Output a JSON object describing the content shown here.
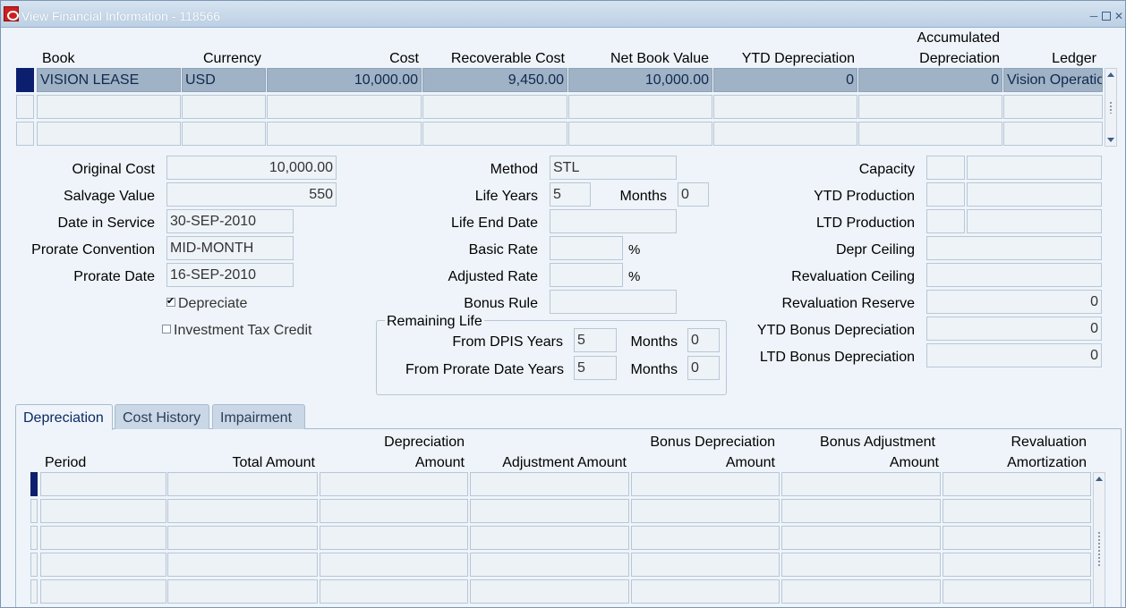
{
  "window": {
    "title": "View Financial Information - 118566"
  },
  "books_table": {
    "headers": {
      "book": "Book",
      "currency": "Currency",
      "cost": "Cost",
      "recoverable_cost": "Recoverable Cost",
      "net_book_value": "Net Book Value",
      "ytd_depreciation": "YTD Depreciation",
      "accumulated_line1": "Accumulated",
      "accumulated_line2": "Depreciation",
      "ledger": "Ledger"
    },
    "rows": [
      {
        "book": "VISION LEASE",
        "currency": "USD",
        "cost": "10,000.00",
        "recoverable_cost": "9,450.00",
        "net_book_value": "10,000.00",
        "ytd_depreciation": "0",
        "accumulated_depreciation": "0",
        "ledger": "Vision Operations"
      },
      {
        "book": "",
        "currency": "",
        "cost": "",
        "recoverable_cost": "",
        "net_book_value": "",
        "ytd_depreciation": "",
        "accumulated_depreciation": "",
        "ledger": ""
      },
      {
        "book": "",
        "currency": "",
        "cost": "",
        "recoverable_cost": "",
        "net_book_value": "",
        "ytd_depreciation": "",
        "accumulated_depreciation": "",
        "ledger": ""
      }
    ]
  },
  "details": {
    "original_cost": {
      "label": "Original Cost",
      "value": "10,000.00"
    },
    "salvage_value": {
      "label": "Salvage Value",
      "value": "550"
    },
    "date_in_service": {
      "label": "Date in Service",
      "value": "30-SEP-2010"
    },
    "prorate_convention": {
      "label": "Prorate Convention",
      "value": "MID-MONTH"
    },
    "prorate_date": {
      "label": "Prorate Date",
      "value": "16-SEP-2010"
    },
    "depreciate": {
      "label": "Depreciate",
      "checked": true
    },
    "investment_tax_credit": {
      "label": "Investment Tax Credit",
      "checked": false
    },
    "method": {
      "label": "Method",
      "value": "STL"
    },
    "life_years": {
      "label": "Life Years",
      "value": "5"
    },
    "life_months": {
      "label": "Months",
      "value": "0"
    },
    "life_end_date": {
      "label": "Life End Date",
      "value": ""
    },
    "basic_rate": {
      "label": "Basic Rate",
      "value": "",
      "unit": "%"
    },
    "adjusted_rate": {
      "label": "Adjusted Rate",
      "value": "",
      "unit": "%"
    },
    "bonus_rule": {
      "label": "Bonus Rule",
      "value": ""
    },
    "remaining_life": {
      "title": "Remaining Life",
      "dpis_label": "From DPIS Years",
      "dpis_years": "5",
      "dpis_months_label": "Months",
      "dpis_months": "0",
      "prorate_label": "From Prorate Date Years",
      "prorate_years": "5",
      "prorate_months_label": "Months",
      "prorate_months": "0"
    },
    "capacity": {
      "label": "Capacity",
      "value": ""
    },
    "ytd_production": {
      "label": "YTD Production",
      "value": ""
    },
    "ltd_production": {
      "label": "LTD Production",
      "value": ""
    },
    "depr_ceiling": {
      "label": "Depr Ceiling",
      "value": ""
    },
    "revaluation_ceiling": {
      "label": "Revaluation Ceiling",
      "value": ""
    },
    "revaluation_reserve": {
      "label": "Revaluation Reserve",
      "value": "0"
    },
    "ytd_bonus_depreciation": {
      "label": "YTD Bonus Depreciation",
      "value": "0"
    },
    "ltd_bonus_depreciation": {
      "label": "LTD Bonus Depreciation",
      "value": "0"
    }
  },
  "tabs": [
    {
      "label": "Depreciation",
      "active": true
    },
    {
      "label": "Cost History",
      "active": false
    },
    {
      "label": "Impairment",
      "active": false
    }
  ],
  "depreciation_table": {
    "headers": {
      "period": "Period",
      "total_amount": "Total Amount",
      "depreciation_line1": "Depreciation",
      "depreciation_line2": "Amount",
      "adjustment_amount": "Adjustment Amount",
      "bonus_depr_line1": "Bonus Depreciation",
      "bonus_depr_line2": "Amount",
      "bonus_adj_line1": "Bonus Adjustment",
      "bonus_adj_line2": "Amount",
      "reval_line1": "Revaluation",
      "reval_line2": "Amortization"
    }
  },
  "colors": {
    "selected_row": "#9fb2c6",
    "record_indicator": "#0b1f6e",
    "window_background": "#eef4f9",
    "title_bar": "#bcd0e4"
  }
}
